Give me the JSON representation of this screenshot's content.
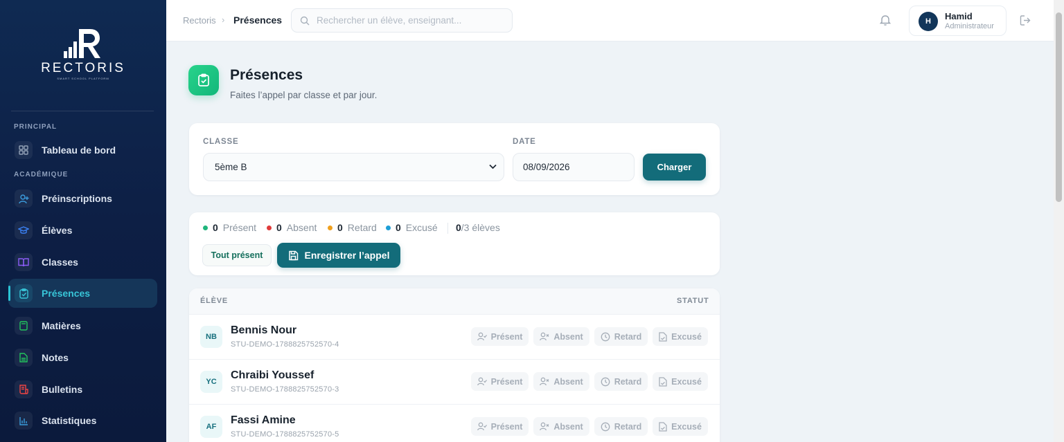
{
  "app": {
    "brand": "RECTORIS",
    "tagline": "SMART SCHOOL PLATFORM"
  },
  "sidebar": {
    "sections": [
      {
        "label": "PRINCIPAL"
      },
      {
        "label": "ACADÉMIQUE"
      }
    ],
    "items": [
      {
        "label": "Tableau de bord",
        "icon": "dashboard-icon",
        "color": "#94a3b8"
      },
      {
        "label": "Préinscriptions",
        "icon": "user-plus-icon",
        "color": "#3b9dde"
      },
      {
        "label": "Élèves",
        "icon": "graduation-cap-icon",
        "color": "#3b82f6"
      },
      {
        "label": "Classes",
        "icon": "book-open-icon",
        "color": "#8b5cf6"
      },
      {
        "label": "Présences",
        "icon": "clipboard-check-icon",
        "color": "#38c5d8",
        "active": true
      },
      {
        "label": "Matières",
        "icon": "book-icon",
        "color": "#22c55e"
      },
      {
        "label": "Notes",
        "icon": "file-text-icon",
        "color": "#22c55e"
      },
      {
        "label": "Bulletins",
        "icon": "receipt-icon",
        "color": "#ef4444"
      },
      {
        "label": "Statistiques",
        "icon": "bar-chart-icon",
        "color": "#3b9dde"
      }
    ]
  },
  "topbar": {
    "breadcrumb_root": "Rectoris",
    "breadcrumb_sep": "›",
    "breadcrumb_current": "Présences",
    "search_placeholder": "Rechercher un élève, enseignant...",
    "user": {
      "initial": "H",
      "name": "Hamid",
      "role": "Administrateur"
    }
  },
  "page": {
    "title": "Présences",
    "subtitle": "Faites l’appel par classe et par jour."
  },
  "filters": {
    "class_label": "CLASSE",
    "class_value": "5ème B",
    "date_label": "DATE",
    "date_value": "08/09/2026",
    "load_button": "Charger"
  },
  "summary": {
    "present": {
      "count": "0",
      "label": "Présent",
      "color": "#1fb57c"
    },
    "absent": {
      "count": "0",
      "label": "Absent",
      "color": "#e03b3b"
    },
    "late": {
      "count": "0",
      "label": "Retard",
      "color": "#f0a01e"
    },
    "excused": {
      "count": "0",
      "label": "Excusé",
      "color": "#1e9ed6"
    },
    "marked": "0",
    "total_text": "/3 élèves",
    "all_present_button": "Tout présent",
    "save_button": "Enregistrer l’appel"
  },
  "table": {
    "col_student": "ÉLÈVE",
    "col_status": "STATUT",
    "status_labels": {
      "present": "Présent",
      "absent": "Absent",
      "late": "Retard",
      "excused": "Excusé"
    },
    "rows": [
      {
        "initials": "NB",
        "name": "Bennis Nour",
        "id": "STU-DEMO-1788825752570-4"
      },
      {
        "initials": "YC",
        "name": "Chraibi Youssef",
        "id": "STU-DEMO-1788825752570-3"
      },
      {
        "initials": "AF",
        "name": "Fassi Amine",
        "id": "STU-DEMO-1788825752570-5"
      }
    ]
  }
}
